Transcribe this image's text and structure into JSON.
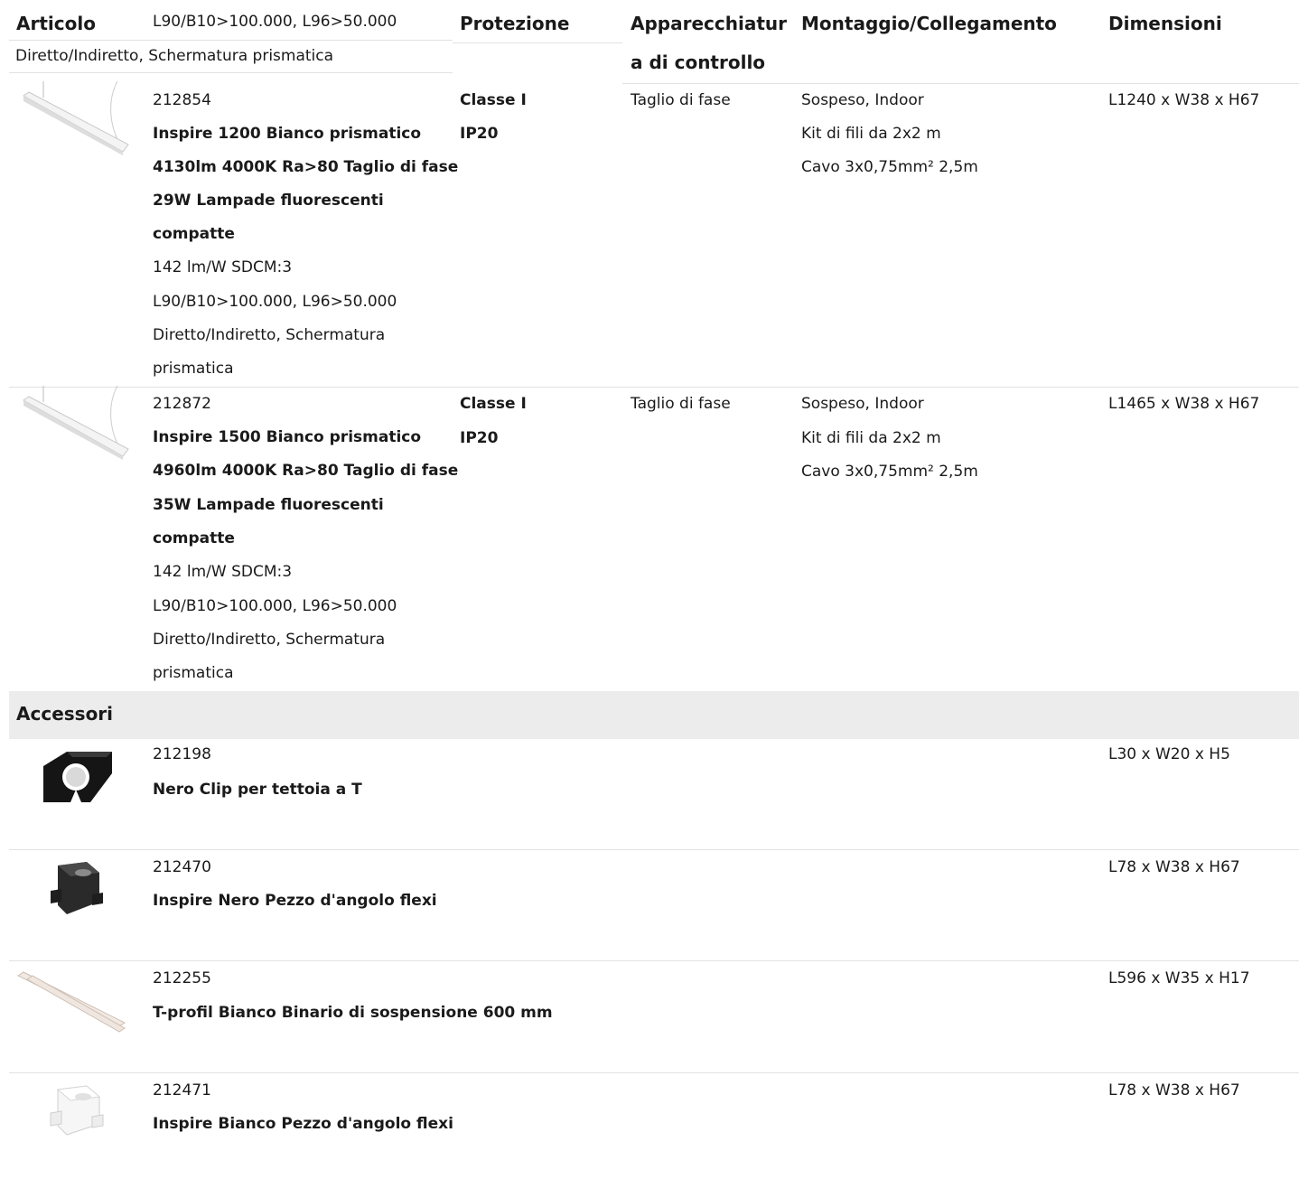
{
  "header": {
    "articolo": "Articolo",
    "overflow_line1": "L90/B10>100.000, L96>50.000",
    "overflow_line2": "Diretto/Indiretto, Schermatura prismatica",
    "protezione": "Protezione",
    "apparecchiatura_1": "Apparecchiatur",
    "apparecchiatura_2": "a di controllo",
    "montaggio": "Montaggio/Collegamento",
    "dimensioni": "Dimensioni"
  },
  "products": [
    {
      "code": "212854",
      "title_lines": [
        "Inspire 1200 Bianco prismatico",
        "4130lm 4000K Ra>80 Taglio di fase",
        "29W Lampade fluorescenti",
        "compatte"
      ],
      "detail_lines": [
        "142 lm/W SDCM:3",
        "L90/B10>100.000, L96>50.000",
        "Diretto/Indiretto, Schermatura",
        "prismatica"
      ],
      "protection": [
        "Classe I",
        "IP20"
      ],
      "control": "Taglio di fase",
      "mounting": [
        "Sospeso, Indoor",
        "Kit di fili da 2x2 m",
        "Cavo 3x0,75mm² 2,5m"
      ],
      "dimensions": "L1240 x W38 x H67"
    },
    {
      "code": "212872",
      "title_lines": [
        "Inspire 1500 Bianco prismatico",
        "4960lm 4000K Ra>80 Taglio di fase",
        "35W Lampade fluorescenti",
        "compatte"
      ],
      "detail_lines": [
        "142 lm/W SDCM:3",
        "L90/B10>100.000, L96>50.000",
        "Diretto/Indiretto, Schermatura",
        "prismatica"
      ],
      "protection": [
        "Classe I",
        "IP20"
      ],
      "control": "Taglio di fase",
      "mounting": [
        "Sospeso, Indoor",
        "Kit di fili da 2x2 m",
        "Cavo 3x0,75mm² 2,5m"
      ],
      "dimensions": "L1465 x W38 x H67"
    }
  ],
  "accessories_title": "Accessori",
  "accessories": [
    {
      "code": "212198",
      "title": "Nero Clip per tettoia a T",
      "dimensions": "L30 x W20 x H5"
    },
    {
      "code": "212470",
      "title": "Inspire Nero Pezzo d'angolo flexi",
      "dimensions": "L78 x W38 x H67"
    },
    {
      "code": "212255",
      "title": "T-profil Bianco Binario di sospensione 600 mm",
      "dimensions": "L596 x W35 x H17"
    },
    {
      "code": "212471",
      "title": "Inspire Bianco Pezzo d'angolo flexi",
      "dimensions": "L78 x W38 x H67"
    }
  ]
}
